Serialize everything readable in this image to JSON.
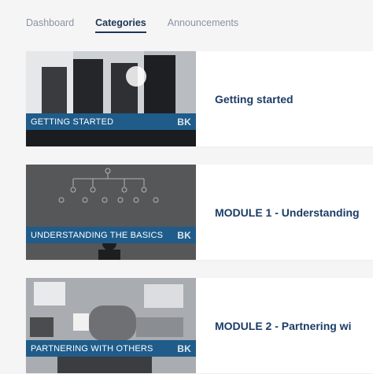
{
  "tabs": [
    {
      "label": "Dashboard"
    },
    {
      "label": "Categories"
    },
    {
      "label": "Announcements"
    }
  ],
  "categories": [
    {
      "banner": "GETTING STARTED",
      "title": "Getting started",
      "logo": "BK"
    },
    {
      "banner": "UNDERSTANDING THE BASICS",
      "title": "MODULE 1 - Understanding",
      "logo": "BK"
    },
    {
      "banner": "PARTNERING WITH OTHERS",
      "title": "MODULE 2 - Partnering wi",
      "logo": "BK"
    }
  ],
  "colors": {
    "accent": "#1c3c66",
    "banner": "#1f5c8a",
    "background": "#f5f5f6"
  }
}
